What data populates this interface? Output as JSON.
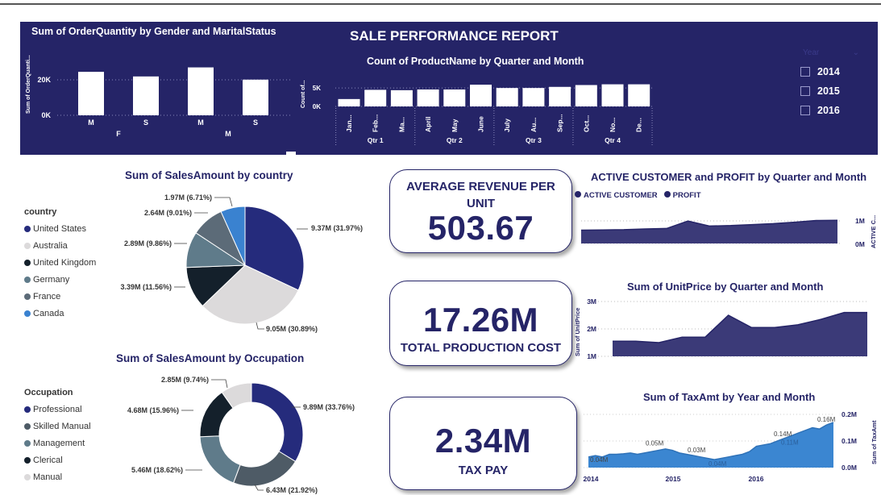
{
  "report": {
    "title": "SALE PERFORMANCE REPORT"
  },
  "slicer": {
    "header": "Year",
    "years": [
      "2014",
      "2015",
      "2016"
    ]
  },
  "kpis": {
    "avg_revenue": {
      "label_top": "AVERAGE REVENUE PER UNIT",
      "value": "503.67"
    },
    "production_cost": {
      "value": "17.26M",
      "label": "TOTAL PRODUCTION COST"
    },
    "tax": {
      "value": "2.34M",
      "label": "TAX PAY"
    }
  },
  "colors": {
    "navy": "#252467",
    "banner": "#252467",
    "area": "#3b3a78",
    "tax_area": "#3b86d1"
  },
  "chart_data": [
    {
      "id": "order_quantity",
      "type": "bar",
      "title": "Sum of OrderQuantity by Gender and MaritalStatus",
      "ylabel": "Sum of OrderQuanti...",
      "xlabel": "",
      "categories": [
        "M",
        "S",
        "M",
        "S"
      ],
      "groups": [
        "F",
        "M"
      ],
      "values": [
        24500,
        21900,
        27000,
        20100
      ],
      "yticks": [
        "20K",
        "0K"
      ],
      "ylim": [
        0,
        30000
      ]
    },
    {
      "id": "product_count",
      "type": "bar",
      "title": "Count of ProductName by Quarter and Month",
      "ylabel": "Count of...",
      "categories": [
        "Jan...",
        "Feb...",
        "Ma...",
        "April",
        "May",
        "June",
        "July",
        "Au...",
        "Sep...",
        "Oct...",
        "No...",
        "De..."
      ],
      "quarters": [
        "Qtr 1",
        "Qtr 2",
        "Qtr 3",
        "Qtr 4"
      ],
      "values": [
        2000,
        4500,
        4400,
        4600,
        4600,
        5900,
        5000,
        5000,
        5300,
        5800,
        6000,
        6000
      ],
      "yticks": [
        "5K",
        "0K"
      ],
      "ylim": [
        0,
        7000
      ]
    },
    {
      "id": "sales_by_country",
      "type": "pie",
      "title": "Sum of SalesAmount by country",
      "legend_title": "country",
      "labels": [
        "United States",
        "Australia",
        "United Kingdom",
        "Germany",
        "France",
        "Canada"
      ],
      "values": [
        9.37,
        9.05,
        3.39,
        2.89,
        2.64,
        1.97
      ],
      "data_labels": [
        "9.37M (31.97%)",
        "9.05M (30.89%)",
        "3.39M (11.56%)",
        "2.89M (9.86%)",
        "2.64M (9.01%)",
        "1.97M (6.71%)"
      ],
      "colors": [
        "#252b7c",
        "#dcdadb",
        "#14202b",
        "#5f7b8a",
        "#5c6b78",
        "#3a82d0"
      ]
    },
    {
      "id": "sales_by_occupation",
      "type": "pie",
      "title": "Sum of SalesAmount by Occupation",
      "legend_title": "Occupation",
      "labels": [
        "Professional",
        "Skilled Manual",
        "Management",
        "Clerical",
        "Manual"
      ],
      "values": [
        9.89,
        6.43,
        5.46,
        4.68,
        2.85
      ],
      "data_labels": [
        "9.89M (33.76%)",
        "6.43M (21.92%)",
        "5.46M (18.62%)",
        "4.68M (15.96%)",
        "2.85M (9.74%)"
      ],
      "colors": [
        "#252b7c",
        "#4e5b66",
        "#5f7b8a",
        "#14202b",
        "#dcdadb"
      ]
    },
    {
      "id": "active_customer_profit",
      "type": "area",
      "title": "ACTIVE CUSTOMER and PROFIT by Quarter and Month",
      "series": [
        {
          "name": "ACTIVE CUSTOMER",
          "values": [
            0.55,
            0.56,
            0.57,
            0.6,
            0.62,
            0.93,
            0.72,
            0.74,
            0.78,
            0.82,
            0.88,
            0.95,
            0.96
          ]
        },
        {
          "name": "PROFIT",
          "values": []
        }
      ],
      "yticks": [
        "1M",
        "0M"
      ],
      "ylabel": "ACTIVE C...",
      "ylim": [
        0,
        1.2
      ]
    },
    {
      "id": "unit_price",
      "type": "area",
      "title": "Sum of UnitPrice by Quarter and Month",
      "ylabel": "Sum of UnitPrice",
      "values": [
        1.55,
        1.55,
        1.5,
        1.7,
        1.7,
        2.5,
        2.05,
        2.05,
        2.15,
        2.35,
        2.6,
        2.6
      ],
      "yticks": [
        "3M",
        "2M",
        "1M"
      ],
      "ylim": [
        1,
        3
      ]
    },
    {
      "id": "tax_amt",
      "type": "area",
      "title": "Sum of TaxAmt by Year and Month",
      "ylabel": "Sum of TaxAmt",
      "x": [
        "2014",
        "2015",
        "2016"
      ],
      "values": [
        0.04,
        0.045,
        0.04,
        0.05,
        0.05,
        0.052,
        0.055,
        0.05,
        0.055,
        0.06,
        0.065,
        0.07,
        0.065,
        0.055,
        0.05,
        0.045,
        0.04,
        0.035,
        0.03,
        0.035,
        0.04,
        0.045,
        0.05,
        0.06,
        0.08,
        0.085,
        0.09,
        0.1,
        0.11,
        0.12,
        0.13,
        0.14,
        0.15,
        0.145,
        0.16,
        0.17
      ],
      "annotations": [
        "0.04M",
        "0.05M",
        "0.03M",
        "0.04M",
        "0.11M",
        "0.14M",
        "0.16M"
      ],
      "yticks": [
        "0.2M",
        "0.1M",
        "0.0M"
      ],
      "ylim": [
        0,
        0.2
      ]
    }
  ]
}
